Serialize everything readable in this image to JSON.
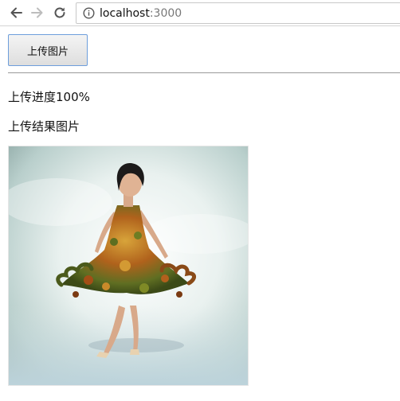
{
  "browser": {
    "url_host": "localhost",
    "url_port": ":3000"
  },
  "page": {
    "upload_button_label": "上传图片",
    "progress_label": "上传进度100%",
    "result_label": "上传结果图片"
  },
  "colors": {
    "button_border": "#6d9edc",
    "divider": "#9a9a9a"
  }
}
